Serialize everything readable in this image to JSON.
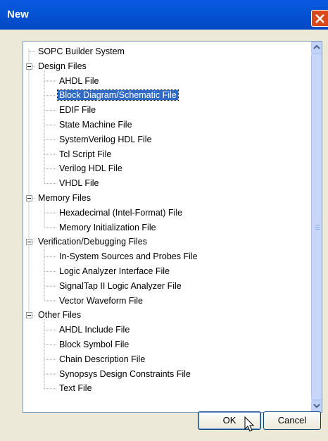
{
  "window": {
    "title": "New"
  },
  "tree": [
    {
      "label": "SOPC Builder System",
      "level": 0,
      "group": false
    },
    {
      "label": "Design Files",
      "level": 0,
      "group": true,
      "expanded": true
    },
    {
      "label": "AHDL File",
      "level": 1
    },
    {
      "label": "Block Diagram/Schematic File",
      "level": 1,
      "selected": true
    },
    {
      "label": "EDIF File",
      "level": 1
    },
    {
      "label": "State Machine File",
      "level": 1
    },
    {
      "label": "SystemVerilog HDL File",
      "level": 1
    },
    {
      "label": "Tcl Script File",
      "level": 1
    },
    {
      "label": "Verilog HDL File",
      "level": 1
    },
    {
      "label": "VHDL File",
      "level": 1
    },
    {
      "label": "Memory Files",
      "level": 0,
      "group": true,
      "expanded": true
    },
    {
      "label": "Hexadecimal (Intel-Format) File",
      "level": 1
    },
    {
      "label": "Memory Initialization File",
      "level": 1
    },
    {
      "label": "Verification/Debugging Files",
      "level": 0,
      "group": true,
      "expanded": true
    },
    {
      "label": "In-System Sources and Probes File",
      "level": 1
    },
    {
      "label": "Logic Analyzer Interface File",
      "level": 1
    },
    {
      "label": "SignalTap II Logic Analyzer File",
      "level": 1
    },
    {
      "label": "Vector Waveform File",
      "level": 1
    },
    {
      "label": "Other Files",
      "level": 0,
      "group": true,
      "expanded": true
    },
    {
      "label": "AHDL Include File",
      "level": 1
    },
    {
      "label": "Block Symbol File",
      "level": 1
    },
    {
      "label": "Chain Description File",
      "level": 1
    },
    {
      "label": "Synopsys Design Constraints File",
      "level": 1
    },
    {
      "label": "Text File",
      "level": 1
    }
  ],
  "buttons": {
    "ok_label": "OK",
    "cancel_label": "Cancel"
  },
  "colors": {
    "selection": "#316ac5",
    "titlebar": "#0454d6",
    "dialog_bg": "#ece9d8"
  }
}
